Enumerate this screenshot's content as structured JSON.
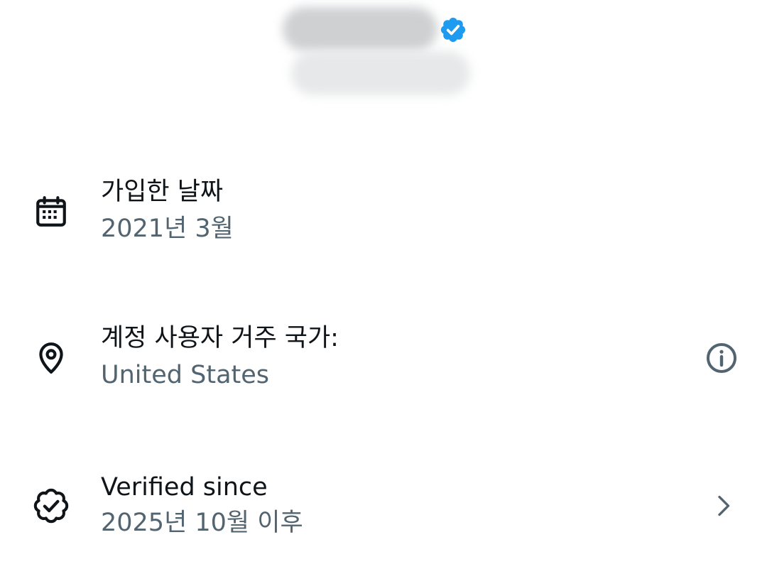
{
  "profile": {
    "name_obscured": "",
    "handle_obscured": "",
    "verified_badge_icon": "verified-badge-icon",
    "verified_badge_color": "#1d9bf0"
  },
  "rows": {
    "joined": {
      "icon": "calendar-icon",
      "title": "가입한 날짜",
      "value": "2021년 3월"
    },
    "country": {
      "icon": "location-pin-icon",
      "title": "계정 사용자 거주 국가:",
      "value": "United States",
      "action_icon": "info-icon"
    },
    "verified": {
      "icon": "verified-check-icon",
      "title": "Verified since",
      "value": "2025년 10월 이후",
      "action_icon": "chevron-right-icon"
    }
  },
  "colors": {
    "primary_text": "#0f1419",
    "secondary_text": "#536471",
    "accent": "#1d9bf0"
  }
}
